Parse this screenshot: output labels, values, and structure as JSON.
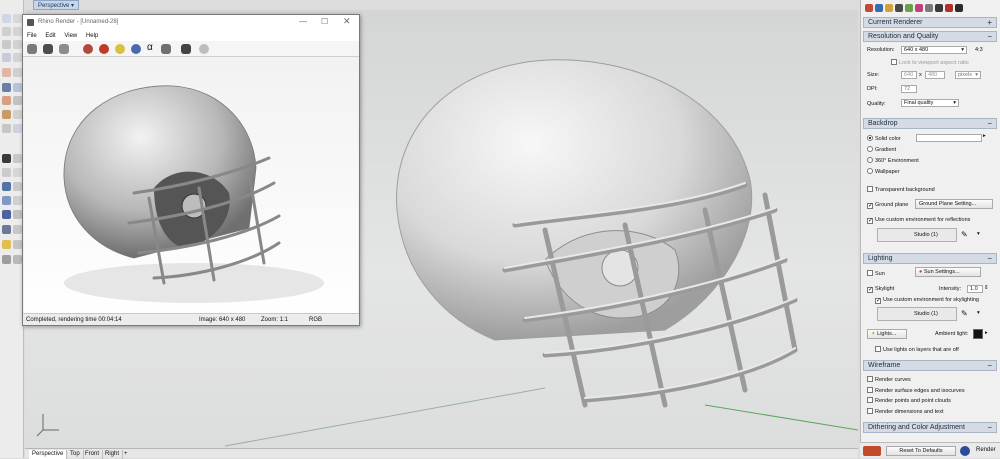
{
  "viewport": {
    "tab_label": "Perspective",
    "bottom_tabs": [
      "Perspective",
      "Top",
      "Front",
      "Right"
    ],
    "add_tab_glyph": "+"
  },
  "render_window": {
    "title": "Rhino Render - [Unnamed-28]",
    "menu": [
      "File",
      "Edit",
      "View",
      "Help"
    ],
    "status": {
      "message": "Completed, rendering time 00:04:14",
      "image": "Image: 640 x 480",
      "zoom": "Zoom: 1:1",
      "mode": "RGB"
    }
  },
  "panel": {
    "current_renderer": "Current Renderer",
    "resolution": {
      "header": "Resolution and Quality",
      "resolution_label": "Resolution:",
      "resolution_value": "640 x 480",
      "aspect": "4:3",
      "lock_label": "Lock to viewport aspect ratio",
      "size_label": "Size:",
      "width": "640",
      "height": "480",
      "unit": "pixels",
      "dpi_label": "DPI:",
      "dpi": "72",
      "quality_label": "Quality:",
      "quality_value": "Final quality"
    },
    "backdrop": {
      "header": "Backdrop",
      "options": [
        "Solid color",
        "Gradient",
        "360° Environment",
        "Wallpaper"
      ],
      "selected": "Solid color",
      "transparent": "Transparent background",
      "ground_plane": "Ground plane",
      "ground_plane_button": "Ground Plane Setting...",
      "custom_env": "Use custom environment for reflections",
      "studio": "Studio (1)"
    },
    "lighting": {
      "header": "Lighting",
      "sun": "Sun",
      "sun_button": "Sun Settings...",
      "skylight": "Skylight",
      "intensity_label": "Intensity:",
      "intensity": "1.0",
      "custom_sky": "Use custom environment for skylighting",
      "studio": "Studio (1)",
      "lights_button": "Lights...",
      "ambient_label": "Ambient light:",
      "layers_off": "Use lights on layers that are off"
    },
    "wireframe": {
      "header": "Wireframe",
      "options": [
        "Render curves",
        "Render surface edges and isocurves",
        "Render points and point clouds",
        "Render dimensions and text"
      ]
    },
    "dithering_header": "Dithering and Color Adjustment",
    "reset_button": "Reset To Defaults",
    "render_button": "Render"
  },
  "colors": {
    "accent": "#d5dbe4",
    "ambient_swatch": "#111111"
  }
}
